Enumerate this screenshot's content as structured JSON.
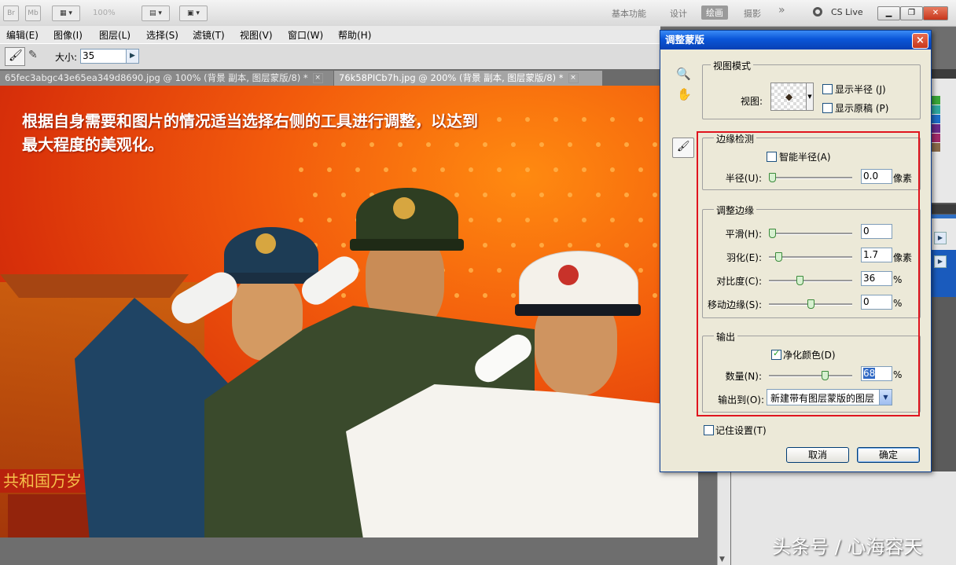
{
  "appbar": {
    "br": "Br",
    "mb": "Mb",
    "zoom": "100%",
    "workspaces": [
      "基本功能",
      "设计",
      "绘画",
      "摄影"
    ],
    "more": "»",
    "cslive": "CS Live"
  },
  "menu": [
    "编辑(E)",
    "图像(I)",
    "图层(L)",
    "选择(S)",
    "滤镜(T)",
    "视图(V)",
    "窗口(W)",
    "帮助(H)"
  ],
  "options": {
    "size_label": "大小:",
    "size_value": "35"
  },
  "tabs": [
    {
      "label": "65fec3abgc43e65ea349d8690.jpg @ 100% (背景 副本, 图层蒙版/8) *",
      "close": "×"
    },
    {
      "label": "76k58PICb7h.jpg @ 200% (背景 副本, 图层蒙版/8) *",
      "close": "×"
    }
  ],
  "canvas": {
    "overlay_text_line1": "根据自身需要和图片的情况适当选择右侧的工具进行调整，以达到",
    "overlay_text_line2": "最大程度的美观化。",
    "banner_text": "共和国万岁"
  },
  "dialog": {
    "title": "调整蒙版",
    "close": "×",
    "view_mode": {
      "group_label": "视图模式",
      "view_label": "视图:",
      "show_radius": "显示半径 (J)",
      "show_original": "显示原稿 (P)"
    },
    "edge_detection": {
      "group_label": "边缘检测",
      "smart_radius": "智能半径(A)",
      "radius_label": "半径(U):",
      "radius_value": "0.0",
      "radius_unit": "像素"
    },
    "adjust_edge": {
      "group_label": "调整边缘",
      "smooth_label": "平滑(H):",
      "smooth_value": "0",
      "feather_label": "羽化(E):",
      "feather_value": "1.7",
      "feather_unit": "像素",
      "contrast_label": "对比度(C):",
      "contrast_value": "36",
      "contrast_unit": "%",
      "shift_label": "移动边缘(S):",
      "shift_value": "0",
      "shift_unit": "%"
    },
    "output": {
      "group_label": "输出",
      "decontaminate": "净化颜色(D)",
      "amount_label": "数量(N):",
      "amount_value": "68",
      "amount_unit": "%",
      "output_to_label": "输出到(O):",
      "output_to_value": "新建带有图层蒙版的图层"
    },
    "remember": "记住设置(T)",
    "cancel": "取消",
    "ok": "确定",
    "slider_levels": {
      "radius": 0.0,
      "smooth": 0.0,
      "feather": 0.08,
      "contrast": 0.36,
      "shift": 0.5,
      "amount": 0.68
    }
  },
  "watermark": "头条号 / 心海容天",
  "colors": {
    "dialog_title": "#0a56d8",
    "highlight_box": "#e0141e",
    "canvas_bg": "#f25a0c"
  }
}
